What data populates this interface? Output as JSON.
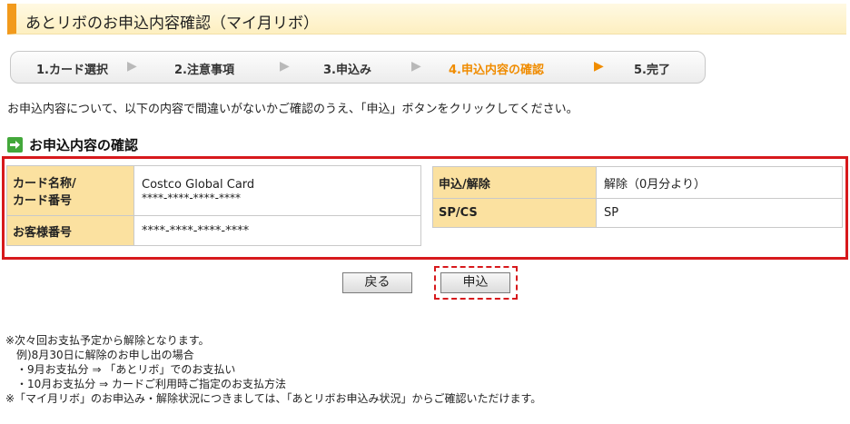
{
  "page_title": "あとリボのお申込内容確認（マイ月リボ）",
  "steps": [
    {
      "label": "1.カード選択",
      "active": false
    },
    {
      "label": "2.注意事項",
      "active": false
    },
    {
      "label": "3.申込み",
      "active": false
    },
    {
      "label": "4.申込内容の確認",
      "active": true
    },
    {
      "label": "5.完了",
      "active": false
    }
  ],
  "arrow_glyph": "▶",
  "intro_text": "お申込内容について、以下の内容で間違いがないかご確認のうえ、「申込」ボタンをクリックしてください。",
  "section_title": "お申込内容の確認",
  "left_table": {
    "card_header_line1": "カード名称/",
    "card_header_line2": "カード番号",
    "card_name": "Costco Global Card",
    "card_number": "****-****-****-****",
    "customer_header": "お客様番号",
    "customer_number": "****-****-****-****"
  },
  "right_table": {
    "apply_header": "申込/解除",
    "apply_value": "解除（0月分より）",
    "spcs_header": "SP/CS",
    "spcs_value": "SP"
  },
  "buttons": {
    "back": "戻る",
    "apply": "申込"
  },
  "notes": [
    "※次々回お支払予定から解除となります。",
    "　例)8月30日に解除のお申し出の場合",
    "　・9月お支払分 ⇒ 「あとリボ」でのお支払い",
    "　・10月お支払分 ⇒ カードご利用時ご指定のお支払方法",
    "※「マイ月リボ」のお申込み・解除状況につきましては、「あとリボお申込み状況」からご確認いただけます。"
  ],
  "colors": {
    "accent_orange": "#f08c00",
    "title_bar_accent": "#f29a1c",
    "header_cell_bg": "#fbe1a0",
    "highlight_red": "#d7191c",
    "section_icon_green": "#43a83b"
  }
}
